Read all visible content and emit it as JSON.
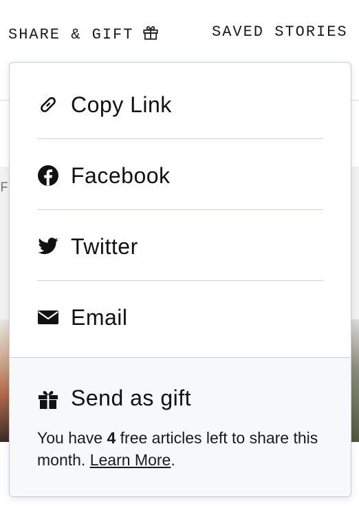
{
  "nav": {
    "share_gift_label": "SHARE & GIFT",
    "share_gift_icon": "gift-icon",
    "saved_stories_label": "SAVED STORIES"
  },
  "background": {
    "partial_letter": "F"
  },
  "share_menu": {
    "items": [
      {
        "label": "Copy Link",
        "icon": "link-icon"
      },
      {
        "label": "Facebook",
        "icon": "facebook-icon"
      },
      {
        "label": "Twitter",
        "icon": "twitter-icon"
      },
      {
        "label": "Email",
        "icon": "envelope-icon"
      }
    ],
    "gift": {
      "label": "Send as gift",
      "icon": "gift-icon",
      "note_prefix": "You have ",
      "free_count": "4",
      "note_suffix": " free articles left to share this month. ",
      "learn_more": "Learn More",
      "period": "."
    }
  },
  "colors": {
    "panel_border": "#c5ccd6",
    "gift_background": "#f7f8fa",
    "text": "#111111"
  }
}
